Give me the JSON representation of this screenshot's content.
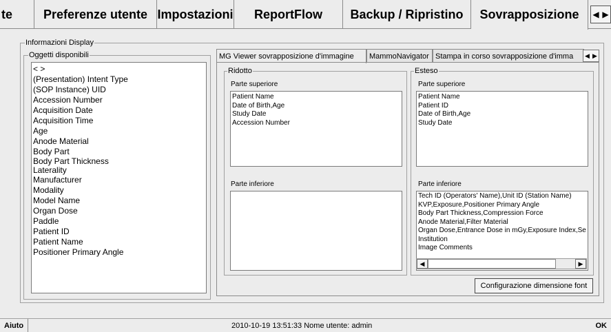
{
  "top_tabs": [
    {
      "label": "te"
    },
    {
      "label": "Preferenze utente"
    },
    {
      "label": "Impostazioni"
    },
    {
      "label": "ReportFlow"
    },
    {
      "label": "Backup / Ripristino"
    },
    {
      "label": "Sovrapposizione"
    }
  ],
  "top_tab_scroll": {
    "left": "◀",
    "right": "▶"
  },
  "display_group": {
    "legend": "Informazioni Display"
  },
  "objects_group": {
    "legend": "Oggetti disponibili",
    "items": [
      "< >",
      "(Presentation) Intent Type",
      "(SOP Instance) UID",
      "Accession Number",
      "Acquisition Date",
      "Acquisition Time",
      "Age",
      "Anode Material",
      "Body Part",
      "Body Part Thickness",
      "Laterality",
      "Manufacturer",
      "Modality",
      "Model Name",
      "Organ Dose",
      "Paddle",
      "Patient ID",
      "Patient Name",
      "Positioner Primary Angle"
    ]
  },
  "inner_tabs": [
    {
      "label": "MG Viewer sovrapposizione d'immagine"
    },
    {
      "label": "MammoNavigator"
    },
    {
      "label": "Stampa in corso sovrapposizione d'imma"
    }
  ],
  "inner_tab_scroll": {
    "left": "◀",
    "right": "▶"
  },
  "ridotto": {
    "legend": "Ridotto",
    "top_label": "Parte superiore",
    "top_items": [
      "Patient Name",
      "Date of Birth,Age",
      "Study Date",
      "Accession Number"
    ],
    "bottom_label": "Parte inferiore",
    "bottom_items": []
  },
  "esteso": {
    "legend": "Esteso",
    "top_label": "Parte superiore",
    "top_items": [
      "Patient Name",
      "Patient ID",
      "Date of Birth,Age",
      "Study Date"
    ],
    "bottom_label": "Parte inferiore",
    "bottom_items": [
      "Tech ID (Operators' Name),Unit ID (Station Name)",
      "KVP,Exposure,Positioner Primary Angle",
      "Body Part Thickness,Compression Force",
      "Anode Material,Filter Material",
      "Organ Dose,Entrance Dose in mGy,Exposure Index,Se",
      "Institution",
      "Image Comments"
    ],
    "scroll_left": "◀",
    "scroll_right": "▶"
  },
  "font_button": {
    "label": "Configurazione dimensione font"
  },
  "statusbar": {
    "help_label": "Aiuto",
    "datetime": "2010-10-19  13:51:33",
    "user_label": "Nome utente:",
    "user_name": "admin",
    "ok_label": "OK"
  }
}
